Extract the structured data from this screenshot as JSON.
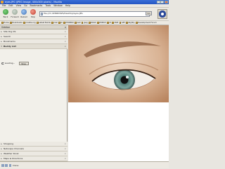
{
  "window": {
    "title": "eyes.JPG (JPEG Image, 400x300 pixels) - Mozilla"
  },
  "menubar": {
    "items": [
      "File",
      "Edit",
      "View",
      "Go",
      "Bookmarks",
      "Tools",
      "Window",
      "Help"
    ]
  },
  "navbar": {
    "back": "Back",
    "forward": "Forward",
    "reload": "Reload",
    "stop": "Stop",
    "url": "file:///C:/WINDOWS/Desktop/eyes.JPG",
    "go": "Go"
  },
  "bookmarks": {
    "items": [
      "Home",
      "Bookmarks",
      "mozilla.org",
      "Latest Builds",
      "mail",
      "KI",
      "PHOENIX",
      "Gall",
      "jpeg",
      "ROAD",
      "PDPOLT",
      "Hi",
      "NVN",
      "GET",
      "Nightly",
      "Development Forum"
    ]
  },
  "sidebar": {
    "title": "Sidebar",
    "close_glyph": "x",
    "panels": [
      "Site Org OS",
      "Search",
      "Bookmarks",
      "Buddy List",
      "Shopping",
      "Netscape Channels",
      "Weather Kiosk",
      "Maps & Directions"
    ],
    "loading_text": "Loading...",
    "stop_label": "Stop"
  },
  "status": {
    "text": "Done"
  },
  "colors": {
    "title_bar": "#2c5fd0",
    "iris": "#6f9a92"
  }
}
